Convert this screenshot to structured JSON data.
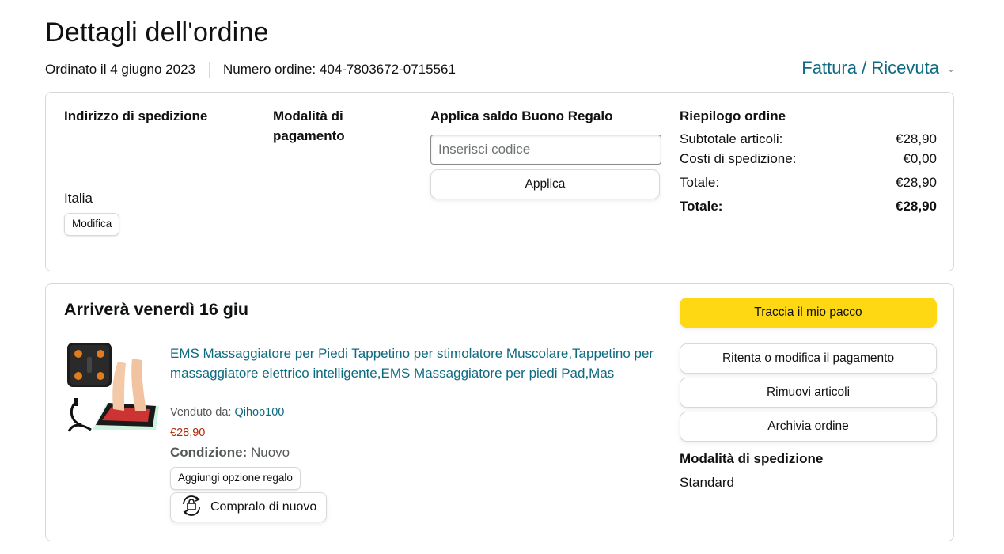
{
  "page": {
    "title": "Dettagli dell'ordine",
    "ordered_on": "Ordinato il 4 giugno 2023",
    "order_number": "Numero ordine: 404-7803672-0715561",
    "invoice_label": "Fattura / Ricevuta"
  },
  "shipping_address": {
    "heading": "Indirizzo di spedizione",
    "country": "Italia",
    "edit_label": "Modifica"
  },
  "payment": {
    "heading": "Modalità di pagamento"
  },
  "gift_card": {
    "heading": "Applica saldo Buono Regalo",
    "placeholder": "Inserisci codice",
    "apply_label": "Applica"
  },
  "summary": {
    "heading": "Riepilogo ordine",
    "rows": [
      {
        "label": "Subtotale articoli:",
        "value": "€28,90"
      },
      {
        "label": "Costi di spedizione:",
        "value": "€0,00"
      },
      {
        "label": "Totale:",
        "value": "€28,90"
      },
      {
        "label": "Totale:",
        "value": "€28,90"
      }
    ]
  },
  "shipment": {
    "arrival": "Arriverà venerdì 16 giu",
    "product_title": "EMS Massaggiatore per Piedi Tappetino per stimolatore Muscolare,Tappetino per massaggiatore elettrico intelligente,EMS Massaggiatore per piedi Pad,Mas",
    "sold_by_label": "Venduto da:",
    "seller": "Qihoo100",
    "price": "€28,90",
    "condition_label": "Condizione:",
    "condition_value": "Nuovo",
    "gift_option_label": "Aggiungi opzione regalo",
    "buy_again_label": "Compralo di nuovo",
    "track_label": "Traccia il mio pacco",
    "actions": [
      "Ritenta o modifica il pagamento",
      "Rimuovi articoli",
      "Archivia ordine"
    ],
    "shipping_method_heading": "Modalità di spedizione",
    "shipping_method_value": "Standard"
  },
  "colors": {
    "link": "#0e6a80",
    "price": "#b12704",
    "primary_button": "#ffd814",
    "border": "#d5d9d9"
  }
}
